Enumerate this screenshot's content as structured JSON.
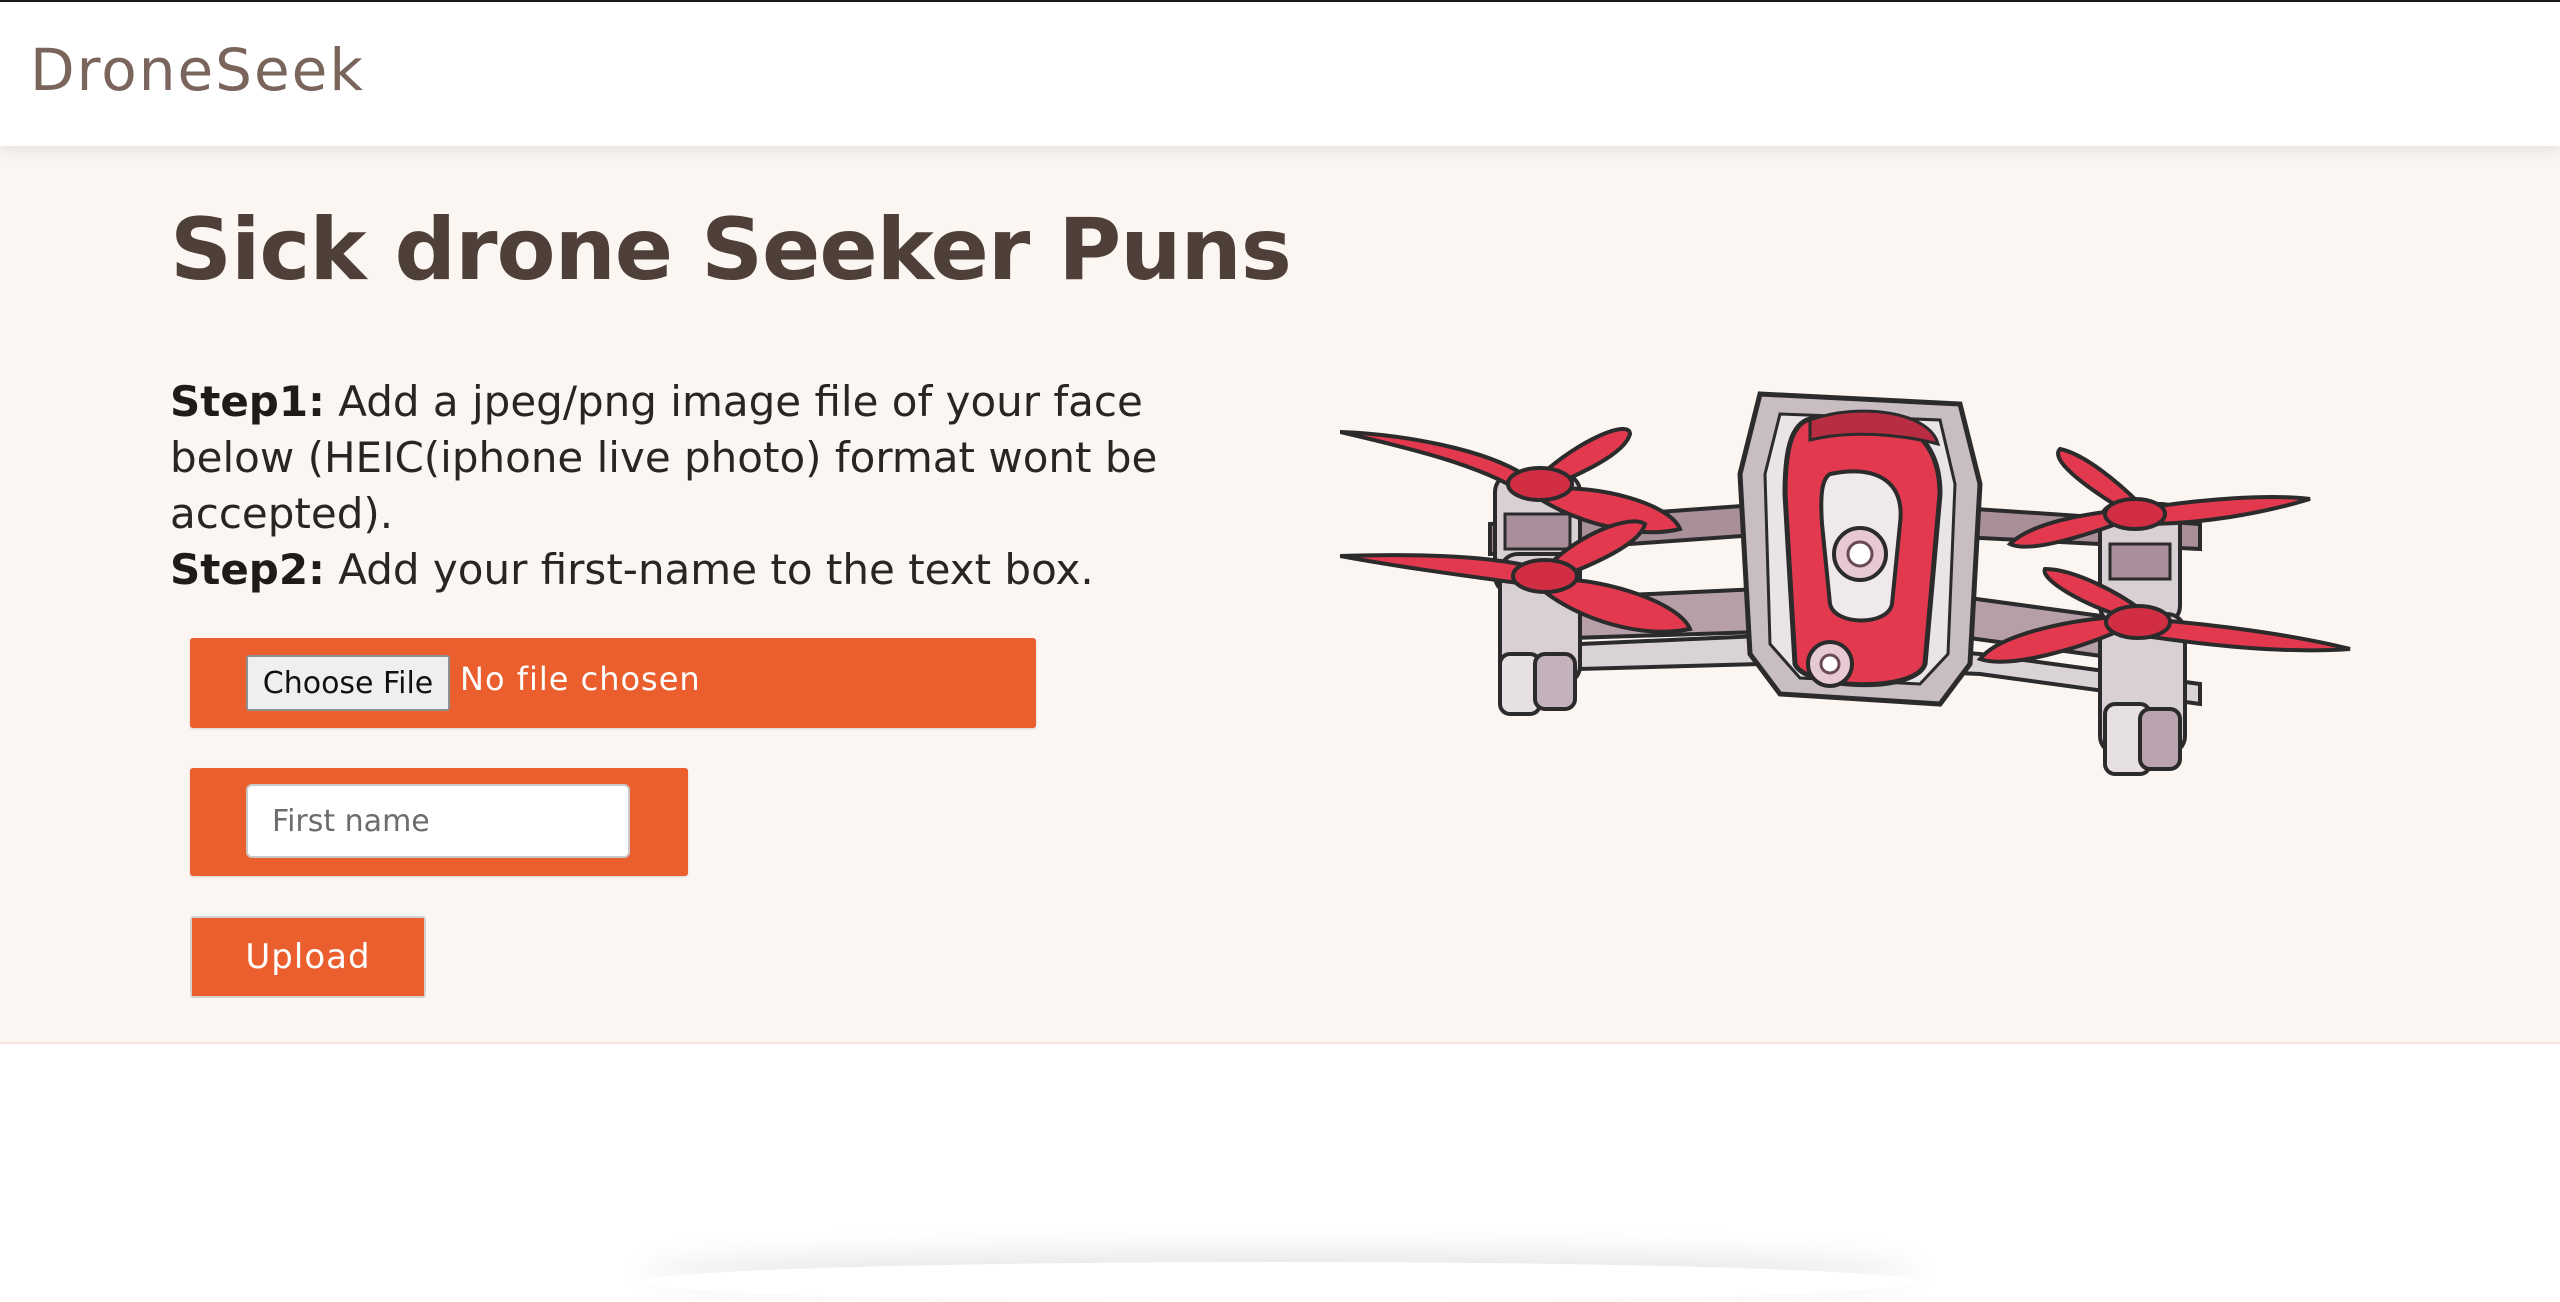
{
  "navbar": {
    "brand": "DroneSeek"
  },
  "hero": {
    "title": "Sick drone Seeker Puns",
    "step1_label": "Step1:",
    "step1_text": " Add a jpeg/png image file of your face below (HEIC(iphone live photo) format wont be accepted).",
    "step2_label": "Step2:",
    "step2_text": " Add your first-name to the text box."
  },
  "form": {
    "choose_file_label": "Choose File",
    "no_file_text": "No file chosen",
    "first_name_placeholder": "First name",
    "first_name_value": "",
    "upload_label": "Upload"
  },
  "colors": {
    "accent": "#eb5e2e",
    "hero_background": "#fbf6f2",
    "title": "#4f3f39",
    "brand": "#7a655c"
  },
  "images": {
    "hero_illustration": "drone-illustration"
  }
}
